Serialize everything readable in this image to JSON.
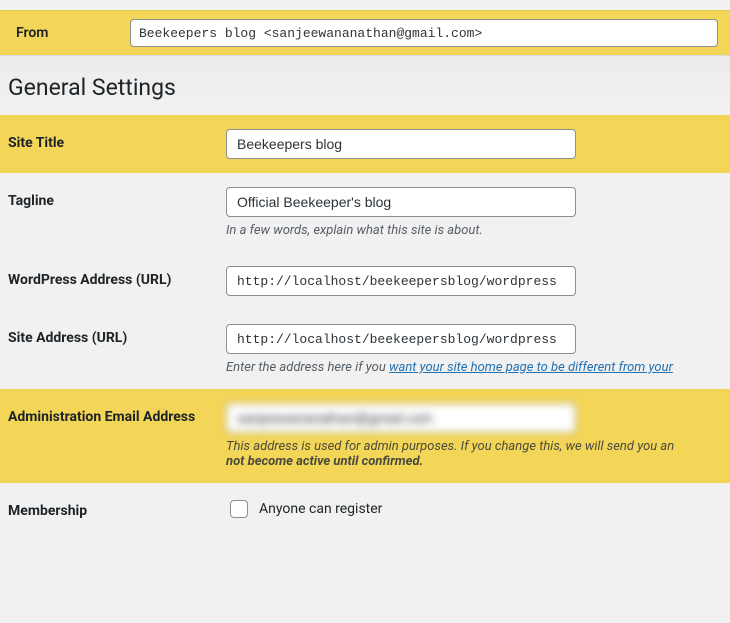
{
  "from_bar": {
    "label": "From",
    "value": "Beekeepers blog <sanjeewananathan@gmail.com>"
  },
  "page_title": "General Settings",
  "settings": {
    "site_title": {
      "label": "Site Title",
      "value": "Beekeepers blog"
    },
    "tagline": {
      "label": "Tagline",
      "value": "Official Beekeeper's blog",
      "desc": "In a few words, explain what this site is about."
    },
    "wp_url": {
      "label": "WordPress Address (URL)",
      "value": "http://localhost/beekeepersblog/wordpress"
    },
    "site_url": {
      "label": "Site Address (URL)",
      "value": "http://localhost/beekeepersblog/wordpress",
      "desc_prefix": "Enter the address here if you ",
      "desc_link": "want your site home page to be different from your"
    },
    "admin_email": {
      "label": "Administration Email Address",
      "value": "sanjeewananathan@gmail.com",
      "desc_prefix": "This address is used for admin purposes. If you change this, we will send you an ",
      "desc_strong": "not become active until confirmed."
    },
    "membership": {
      "label": "Membership",
      "checkbox_label": "Anyone can register",
      "checked": false
    }
  }
}
